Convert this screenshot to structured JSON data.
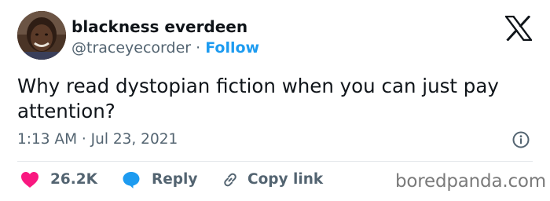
{
  "author": {
    "display_name": "blackness everdeen",
    "handle": "@tracey​ecorder",
    "separator": " · ",
    "follow_label": "Follow"
  },
  "tweet": {
    "text": "Why read dystopian fiction when you can just pay attention?",
    "timestamp": "1:13 AM · Jul 23, 2021"
  },
  "actions": {
    "like_count": "26.2K",
    "reply_label": "Reply",
    "copy_link_label": "Copy link"
  },
  "watermark": "boredpanda.com",
  "colors": {
    "accent": "#1d9bf0",
    "like": "#f91880",
    "text_primary": "#0f1419",
    "text_secondary": "#536471"
  },
  "icons": {
    "platform": "x-logo-icon",
    "info": "info-icon",
    "like": "heart-icon",
    "reply": "speech-bubble-icon",
    "copy_link": "link-icon"
  }
}
